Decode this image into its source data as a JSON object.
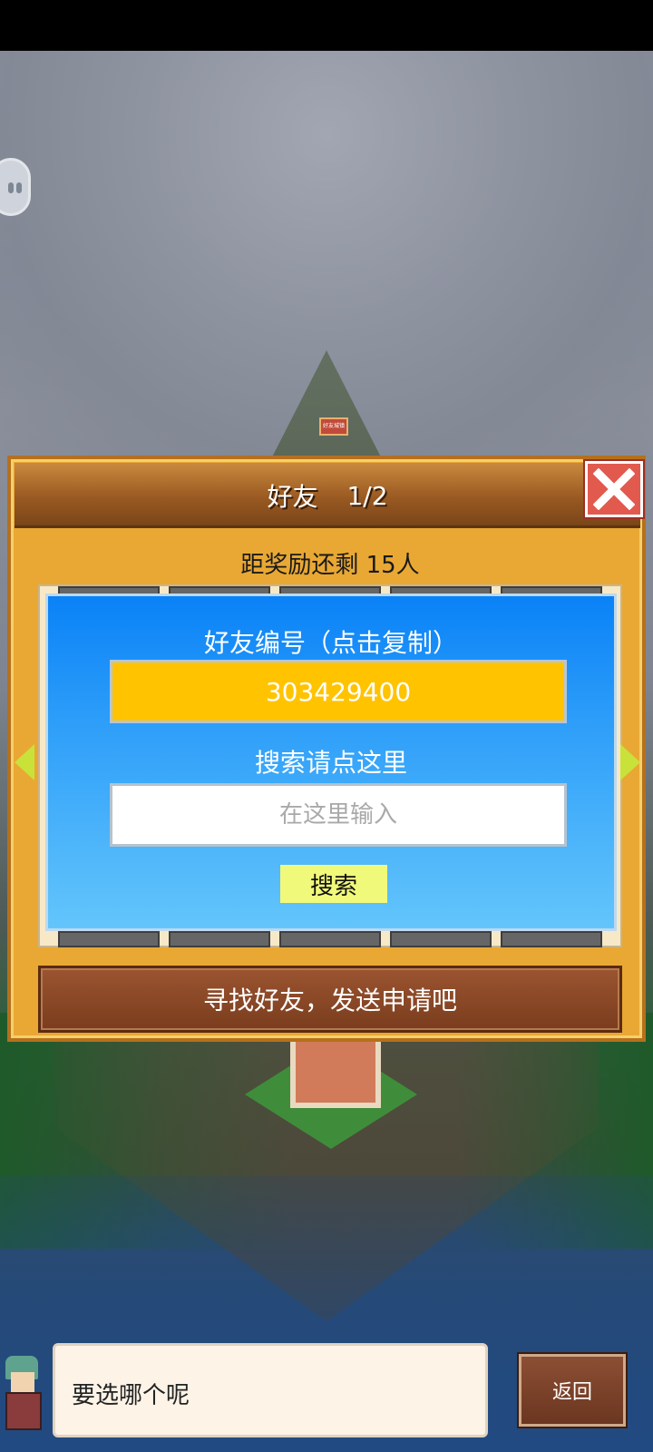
{
  "header": {
    "title": "好友",
    "page_indicator": "1/2"
  },
  "reward": {
    "text": "距奖励还剩 15人"
  },
  "friend_code": {
    "label": "好友编号（点击复制）",
    "value": "303429400"
  },
  "search": {
    "label": "搜索请点这里",
    "placeholder": "在这里输入",
    "button_label": "搜索"
  },
  "find_friends": {
    "label": "寻找好友，发送申请吧"
  },
  "dialog": {
    "text": "要选哪个呢"
  },
  "back_button": {
    "label": "返回"
  },
  "map_sign": {
    "text": "好友城镇"
  },
  "colors": {
    "panel": "#e9a833",
    "blue_box": "#0a82f7",
    "friend_code_bg": "#ffc300",
    "search_button_bg": "#f1f97a",
    "close_button": "#e25a4e"
  }
}
